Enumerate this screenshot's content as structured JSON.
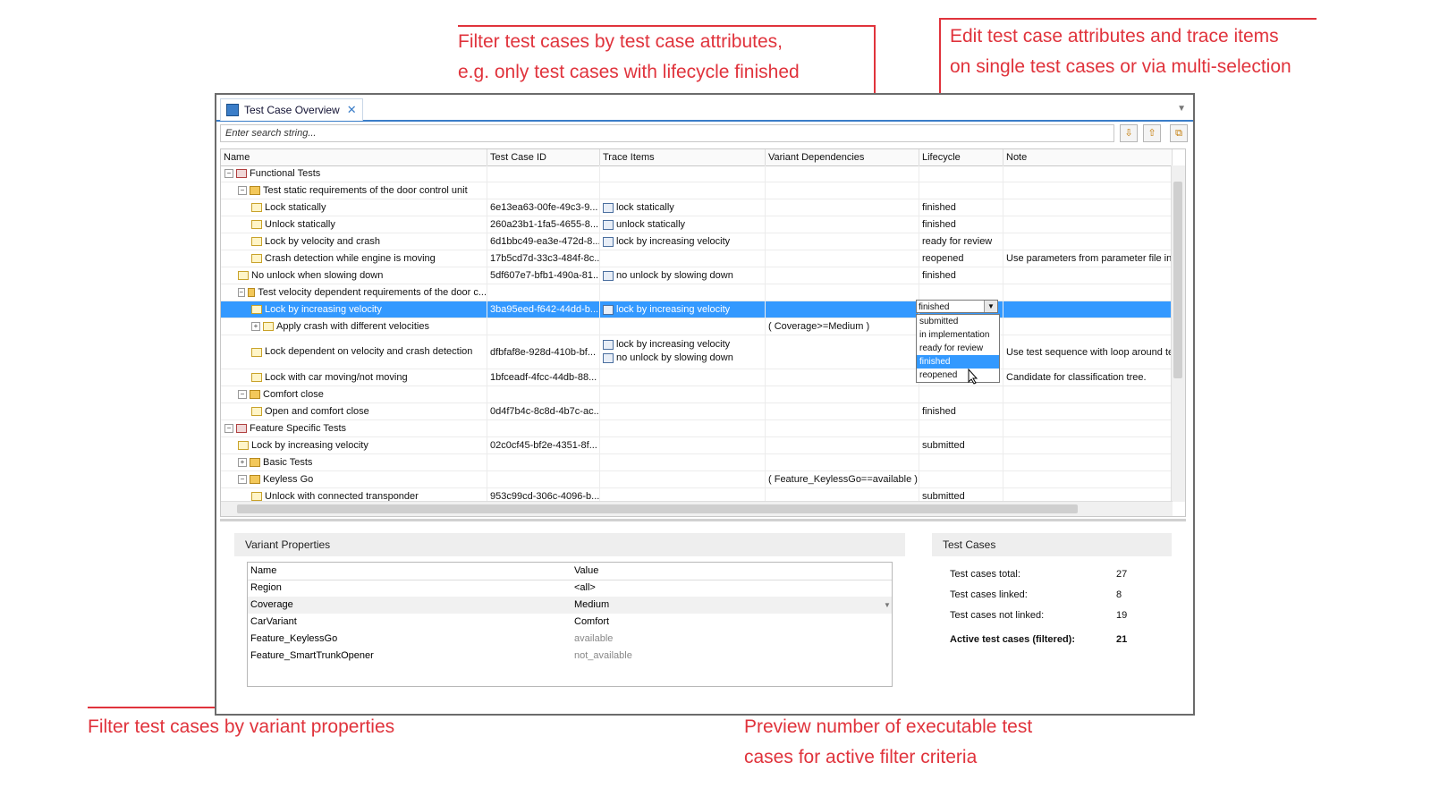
{
  "callouts": {
    "filter_attributes": {
      "line1": "Filter test cases by test case attributes,",
      "line2": "e.g. only test cases with lifecycle finished"
    },
    "edit_attributes": {
      "line1": "Edit test case attributes and trace items",
      "line2": "on single test cases or via multi-selection"
    },
    "filter_variant": {
      "line1": "Filter test cases by variant properties"
    },
    "preview_count": {
      "line1": "Preview number of executable test",
      "line2": "cases for active filter criteria"
    }
  },
  "window": {
    "tab_title": "Test Case Overview",
    "search_placeholder": "Enter search string..."
  },
  "table": {
    "columns": [
      "Name",
      "Test Case ID",
      "Trace Items",
      "Variant Dependencies",
      "Lifecycle",
      "Note"
    ],
    "rows": [
      {
        "name": "Functional Tests",
        "id": "",
        "trace": [],
        "variant": "",
        "lifecycle": "",
        "note": "",
        "icon": "group-icon"
      },
      {
        "name": "Test static requirements of the door control unit",
        "id": "",
        "trace": [],
        "variant": "",
        "lifecycle": "",
        "note": "",
        "icon": "folder-icon"
      },
      {
        "name": "Lock statically",
        "id": "6e13ea63-00fe-49c3-9...",
        "trace": [
          "lock statically"
        ],
        "variant": "",
        "lifecycle": "finished",
        "note": "",
        "icon": "test-case-icon"
      },
      {
        "name": "Unlock statically",
        "id": "260a23b1-1fa5-4655-8...",
        "trace": [
          "unlock statically"
        ],
        "variant": "",
        "lifecycle": "finished",
        "note": "",
        "icon": "test-case-icon"
      },
      {
        "name": "Lock by velocity and crash",
        "id": "6d1bbc49-ea3e-472d-8...",
        "trace": [
          "lock by increasing velocity"
        ],
        "variant": "",
        "lifecycle": "ready for review",
        "note": "",
        "icon": "test-case-icon"
      },
      {
        "name": "Crash detection while engine is moving",
        "id": "17b5cd7d-33c3-484f-8c...",
        "trace": [],
        "variant": "",
        "lifecycle": "reopened",
        "note": "Use parameters from parameter file inst",
        "icon": "test-case-icon"
      },
      {
        "name": "No unlock when slowing down",
        "id": "5df607e7-bfb1-490a-81...",
        "trace": [
          "no unlock by slowing down"
        ],
        "variant": "",
        "lifecycle": "finished",
        "note": "",
        "icon": "test-case-icon"
      },
      {
        "name": "Test velocity dependent requirements of the door c...",
        "id": "",
        "trace": [],
        "variant": "",
        "lifecycle": "",
        "note": "",
        "icon": "folder-icon"
      },
      {
        "name": "Lock by increasing velocity",
        "id": "3ba95eed-f642-44dd-b...",
        "trace": [
          "lock by increasing velocity"
        ],
        "variant": "",
        "lifecycle": "finished",
        "note": "",
        "icon": "test-case-icon",
        "selected": true
      },
      {
        "name": "Apply crash with different velocities",
        "id": "",
        "trace": [],
        "variant": "( Coverage>=Medium )",
        "lifecycle": "",
        "note": "",
        "icon": "parameter-icon"
      },
      {
        "name": "Lock dependent on velocity and crash detection",
        "id": "dfbfaf8e-928d-410b-bf...",
        "trace": [
          "lock by increasing velocity",
          "no unlock by slowing down"
        ],
        "variant": "",
        "lifecycle": "",
        "note": "Use test sequence with loop around test",
        "icon": "test-case-icon",
        "tall": true
      },
      {
        "name": "Lock with car moving/not moving",
        "id": "1bfceadf-4fcc-44db-88...",
        "trace": [],
        "variant": "",
        "lifecycle": "",
        "note": "Candidate for classification tree.",
        "icon": "test-case-icon"
      },
      {
        "name": "Comfort close",
        "id": "",
        "trace": [],
        "variant": "",
        "lifecycle": "",
        "note": "",
        "icon": "folder-icon"
      },
      {
        "name": "Open and comfort close",
        "id": "0d4f7b4c-8c8d-4b7c-ac...",
        "trace": [],
        "variant": "",
        "lifecycle": "finished",
        "note": "",
        "icon": "test-case-icon"
      },
      {
        "name": "Feature Specific Tests",
        "id": "",
        "trace": [],
        "variant": "",
        "lifecycle": "",
        "note": "",
        "icon": "group-icon"
      },
      {
        "name": "Lock by increasing velocity",
        "id": "02c0cf45-bf2e-4351-8f...",
        "trace": [],
        "variant": "",
        "lifecycle": "submitted",
        "note": "",
        "icon": "test-case-icon"
      },
      {
        "name": "Basic Tests",
        "id": "",
        "trace": [],
        "variant": "",
        "lifecycle": "",
        "note": "",
        "icon": "folder-icon"
      },
      {
        "name": "Keyless Go",
        "id": "",
        "trace": [],
        "variant": "( Feature_KeylessGo==available )",
        "lifecycle": "",
        "note": "",
        "icon": "folder-icon"
      },
      {
        "name": "Unlock with connected transponder",
        "id": "953c99cd-306c-4096-b...",
        "trace": [],
        "variant": "",
        "lifecycle": "submitted",
        "note": "",
        "icon": "test-case-icon"
      }
    ]
  },
  "lifecycle_dropdown": {
    "current": "finished",
    "options": [
      "submitted",
      "in implementation",
      "ready for review",
      "finished",
      "reopened"
    ],
    "highlighted": "finished"
  },
  "variant_properties": {
    "title": "Variant Properties",
    "headers": [
      "Name",
      "Value"
    ],
    "rows": [
      {
        "name": "Region",
        "value": "<all>"
      },
      {
        "name": "Coverage",
        "value": "Medium"
      },
      {
        "name": "CarVariant",
        "value": "Comfort"
      },
      {
        "name": "Feature_KeylessGo",
        "value": "available"
      },
      {
        "name": "Feature_SmartTrunkOpener",
        "value": "not_available"
      }
    ]
  },
  "test_cases": {
    "title": "Test Cases",
    "total_label": "Test cases total:",
    "total": "27",
    "linked_label": "Test cases linked:",
    "linked": "8",
    "not_linked_label": "Test cases not linked:",
    "not_linked": "19",
    "active_label": "Active test cases (filtered):",
    "active": "21"
  },
  "colors": {
    "callout": "#e0333c",
    "selection": "#3399ff",
    "tab_accent": "#3a7dc8"
  }
}
